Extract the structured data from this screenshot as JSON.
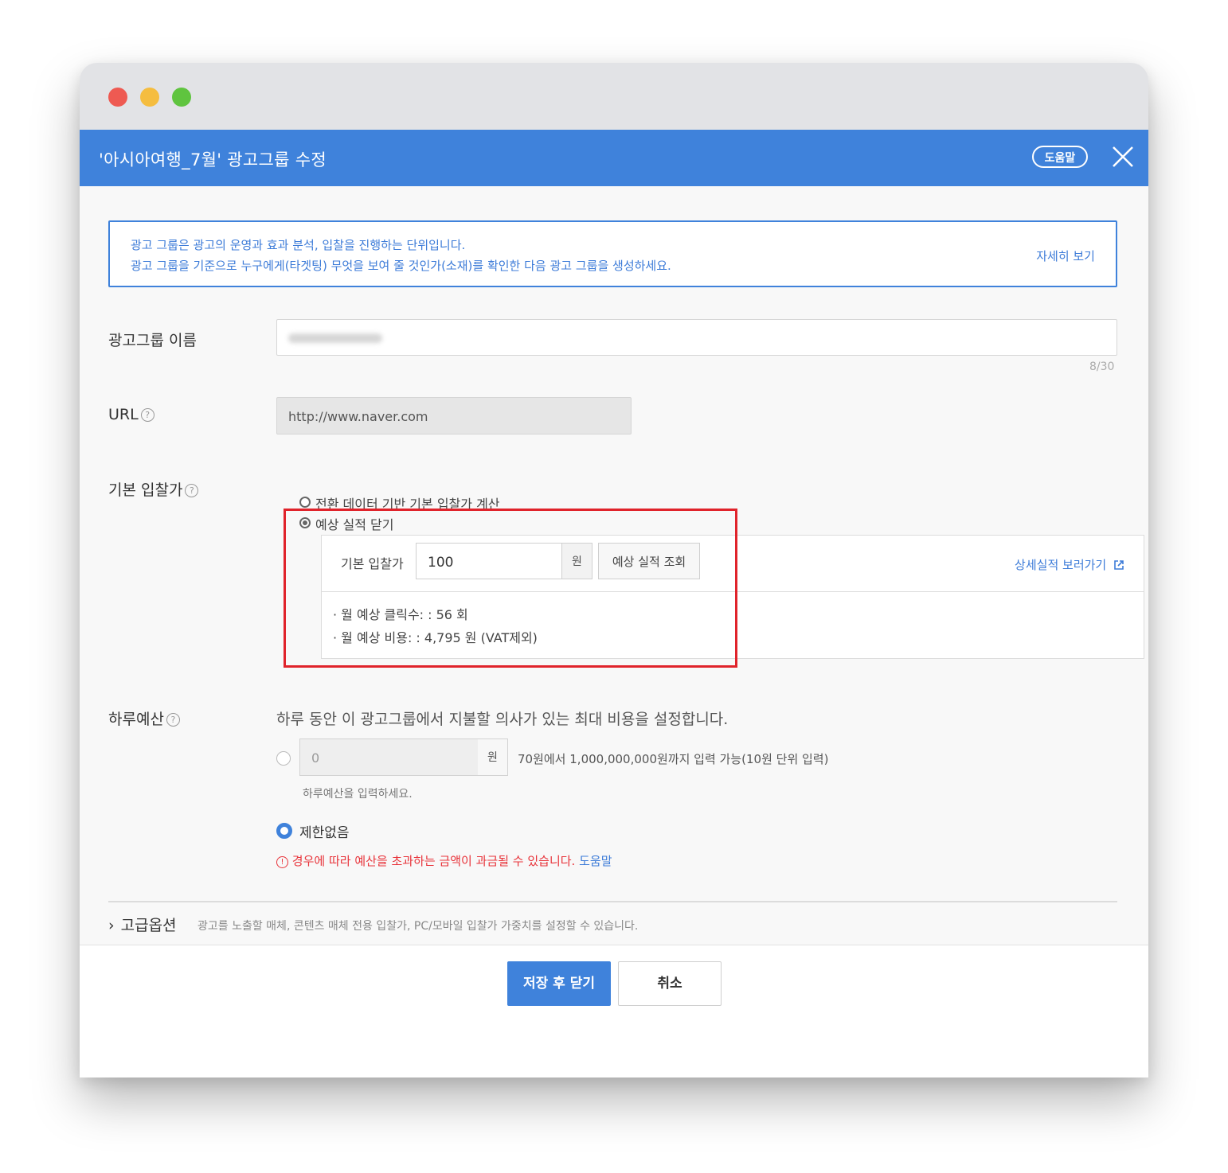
{
  "dialog": {
    "title": "'아시아여행_7월' 광고그룹 수정",
    "help_label": "도움말"
  },
  "notice": {
    "line1": "광고 그룹은 광고의 운영과 효과 분석, 입찰을 진행하는 단위입니다.",
    "line2": "광고 그룹을 기준으로 누구에게(타겟팅) 무엇을 보여 줄 것인가(소재)를 확인한 다음 광고 그룹을 생성하세요.",
    "more_link": "자세히 보기"
  },
  "name_field": {
    "label": "광고그룹 이름",
    "counter": "8/30"
  },
  "url_field": {
    "label": "URL",
    "value": "http://www.naver.com"
  },
  "bid": {
    "label": "기본 입찰가",
    "option_conversion": "전환 데이터 기반 기본 입찰가 계산",
    "option_close_estimate": "예상 실적 닫기",
    "bid_label": "기본 입찰가",
    "bid_value": "100",
    "unit": "원",
    "estimate_button": "예상 실적 조회",
    "detail_link": "상세실적 보러가기",
    "stat_clicks": "월 예상 클릭수: : 56 회",
    "stat_cost": "월 예상 비용: : 4,795 원 (VAT제외)"
  },
  "daily_budget": {
    "label": "하루예산",
    "description": "하루 동안 이 광고그룹에서 지불할 의사가 있는 최대 비용을 설정합니다.",
    "value": "0",
    "unit": "원",
    "range_text": "70원에서 1,000,000,000원까지 입력 가능(10원 단위 입력)",
    "hint": "하루예산을 입력하세요.",
    "unlimited_label": "제한없음",
    "warning_text": "경우에 따라 예산을 초과하는 금액이 과금될 수 있습니다.",
    "warning_link": "도움말"
  },
  "advanced": {
    "label": "고급옵션",
    "description": "광고를 노출할 매체, 콘텐츠 매체 전용 입찰가, PC/모바일 입찰가 가중치를 설정할 수 있습니다."
  },
  "footer": {
    "save_label": "저장 후 닫기",
    "cancel_label": "취소"
  },
  "colors": {
    "accent": "#3f82db",
    "highlight": "#e0232b",
    "warning": "#e8333a"
  }
}
